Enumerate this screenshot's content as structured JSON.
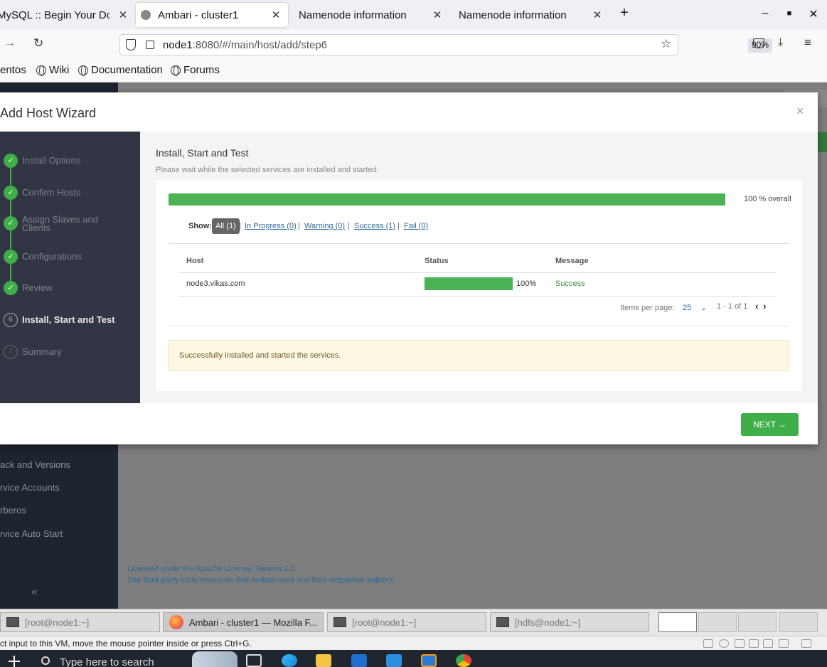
{
  "browser": {
    "tabs": [
      {
        "label": "MySQL :: Begin Your Download",
        "active": false
      },
      {
        "label": "Ambari - cluster1",
        "active": true
      },
      {
        "label": "Namenode information",
        "active": false
      },
      {
        "label": "Namenode information",
        "active": false
      }
    ],
    "url_host": "node1",
    "url_rest": ":8080/#/main/host/add/step6",
    "zoom": "90%",
    "bookmarks": [
      "entos",
      "Wiki",
      "Documentation",
      "Forums"
    ]
  },
  "app": {
    "sidebar_links": [
      "ack and Versions",
      "rvice Accounts",
      "rberos",
      "rvice Auto Start"
    ],
    "footer_links": [
      "Licensed under the Apache License, Version 2.0.",
      "See third-party tools/resources that Ambari uses and their respective authors"
    ]
  },
  "wizard": {
    "title": "Add Host Wizard",
    "close": "×",
    "steps": [
      {
        "label": "Install Options",
        "marker": "✓",
        "state": "done"
      },
      {
        "label": "Confirm Hosts",
        "marker": "✓",
        "state": "done"
      },
      {
        "label": "Assign Slaves and Clients",
        "marker": "✓",
        "state": "done"
      },
      {
        "label": "Configurations",
        "marker": "✓",
        "state": "done"
      },
      {
        "label": "Review",
        "marker": "✓",
        "state": "done"
      },
      {
        "label": "Install, Start and Test",
        "marker": "6",
        "state": "active"
      },
      {
        "label": "Summary",
        "marker": "7",
        "state": "pending"
      }
    ],
    "content": {
      "title": "Install, Start and Test",
      "subtitle": "Please wait while the selected services are installed and started.",
      "overall_progress": 1.0,
      "overall_text": "100 % overall",
      "show_label": "Show:",
      "filters": {
        "all": "All (1)",
        "in_progress": "In Progress (0)",
        "warning": "Warning (0)",
        "success": "Success (1)",
        "fail": "Fail (0)"
      },
      "table": {
        "headers": {
          "host": "Host",
          "status": "Status",
          "message": "Message"
        },
        "rows": [
          {
            "host": "node3.vikas.com",
            "progress": 1.0,
            "percent": "100%",
            "message": "Success"
          }
        ]
      },
      "pagination": {
        "items_per_page_label": "Items per page:",
        "items_per_page": "25",
        "range": "1 - 1 of 1"
      },
      "notice": "Successfully installed and started the services."
    },
    "next_button": "NEXT →"
  },
  "vm": {
    "tasks": [
      {
        "label": "[root@node1:~]",
        "active": false
      },
      {
        "label": "Ambari - cluster1 — Mozilla F...",
        "active": true
      },
      {
        "label": "[root@node1:~]",
        "active": false
      },
      {
        "label": "[hdfs@node1:~]",
        "active": false
      }
    ],
    "status_text": "ct input to this VM, move the mouse pointer inside or press Ctrl+G."
  },
  "windows": {
    "search_placeholder": "Type here to search"
  },
  "colors": {
    "success_green": "#4ab255",
    "sidebar_dark": "#323544",
    "link_blue": "#2b6a9a"
  }
}
